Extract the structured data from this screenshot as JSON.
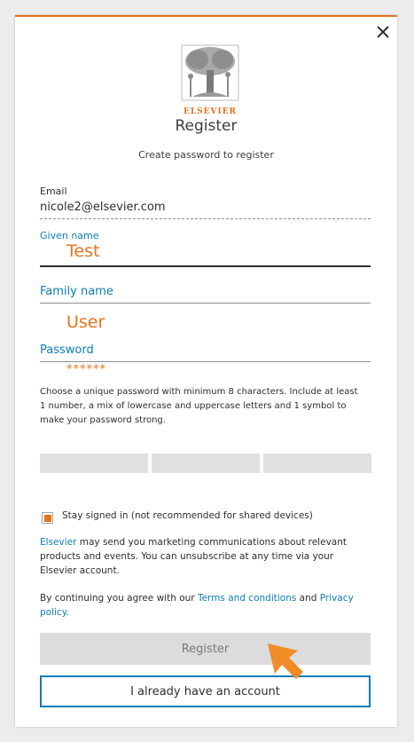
{
  "header": {
    "brand": "ELSEVIER",
    "title": "Register",
    "subtitle": "Create password to register"
  },
  "accent_color": "#e9711c",
  "link_color": "#0c7dbb",
  "form": {
    "email_label": "Email",
    "email_value": "nicole2@elsevier.com",
    "given_name_label": "Given name",
    "given_name_value": "Test",
    "family_name_label": "Family name",
    "family_name_value": "User",
    "password_label": "Password",
    "password_value": "******",
    "password_help": "Choose a unique password with minimum 8 characters. Include at least 1 number, a mix of lowercase and uppercase letters and 1 symbol to make your password strong."
  },
  "stay_signed_in": {
    "label": "Stay signed in (not recommended for shared devices)",
    "checked": true
  },
  "marketing": {
    "link": "Elsevier",
    "text": " may send you marketing communications about relevant products and events. You can unsubscribe at any time via your Elsevier account."
  },
  "agreement": {
    "prefix": "By continuing you agree with our ",
    "terms": "Terms and conditions",
    "and": " and ",
    "privacy": "Privacy policy",
    "suffix": "."
  },
  "buttons": {
    "register": "Register",
    "have_account": "I already have an account"
  },
  "icons": {
    "close": "close-icon",
    "logo": "elsevier-tree-logo",
    "pointer": "arrow-pointer-icon"
  }
}
